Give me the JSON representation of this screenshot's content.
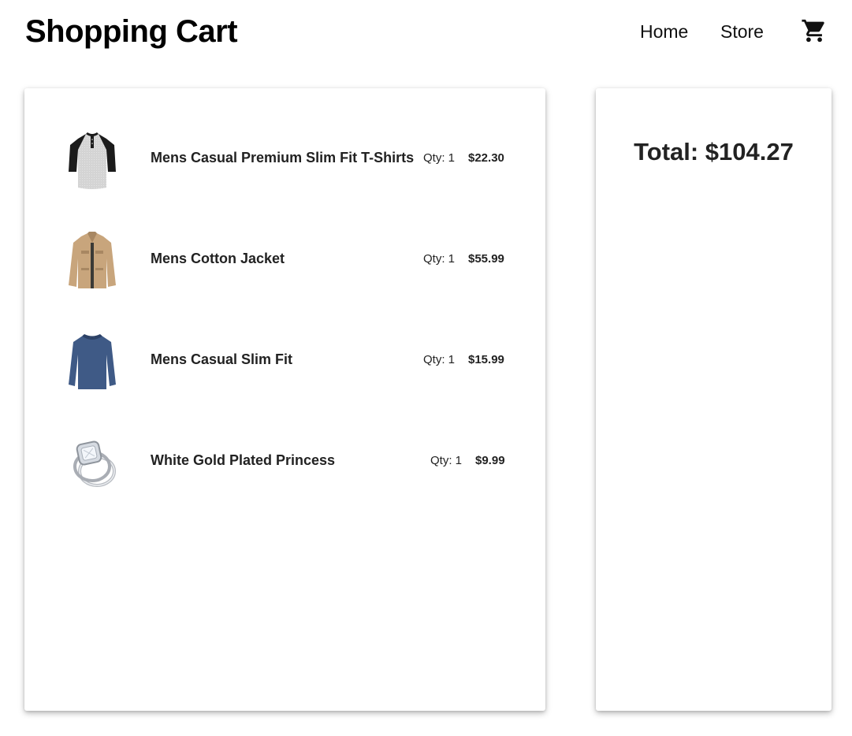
{
  "header": {
    "title": "Shopping Cart",
    "nav": [
      {
        "label": "Home"
      },
      {
        "label": "Store"
      }
    ],
    "cart_icon": "shopping-cart-icon"
  },
  "cart": {
    "items": [
      {
        "name": "Mens Casual Premium Slim Fit T-Shirts",
        "qty": "Qty: 1",
        "price": "$22.30",
        "image_icon": "raglan-tshirt-image"
      },
      {
        "name": "Mens Cotton Jacket",
        "qty": "Qty: 1",
        "price": "$55.99",
        "image_icon": "cotton-jacket-image"
      },
      {
        "name": "Mens Casual Slim Fit",
        "qty": "Qty: 1",
        "price": "$15.99",
        "image_icon": "slim-fit-shirt-image"
      },
      {
        "name": "White Gold Plated Princess",
        "qty": "Qty: 1",
        "price": "$9.99",
        "image_icon": "ring-image"
      }
    ]
  },
  "summary": {
    "total": "Total: $104.27"
  },
  "colors": {
    "text": "#222222",
    "title": "#000000",
    "background": "#ffffff"
  }
}
